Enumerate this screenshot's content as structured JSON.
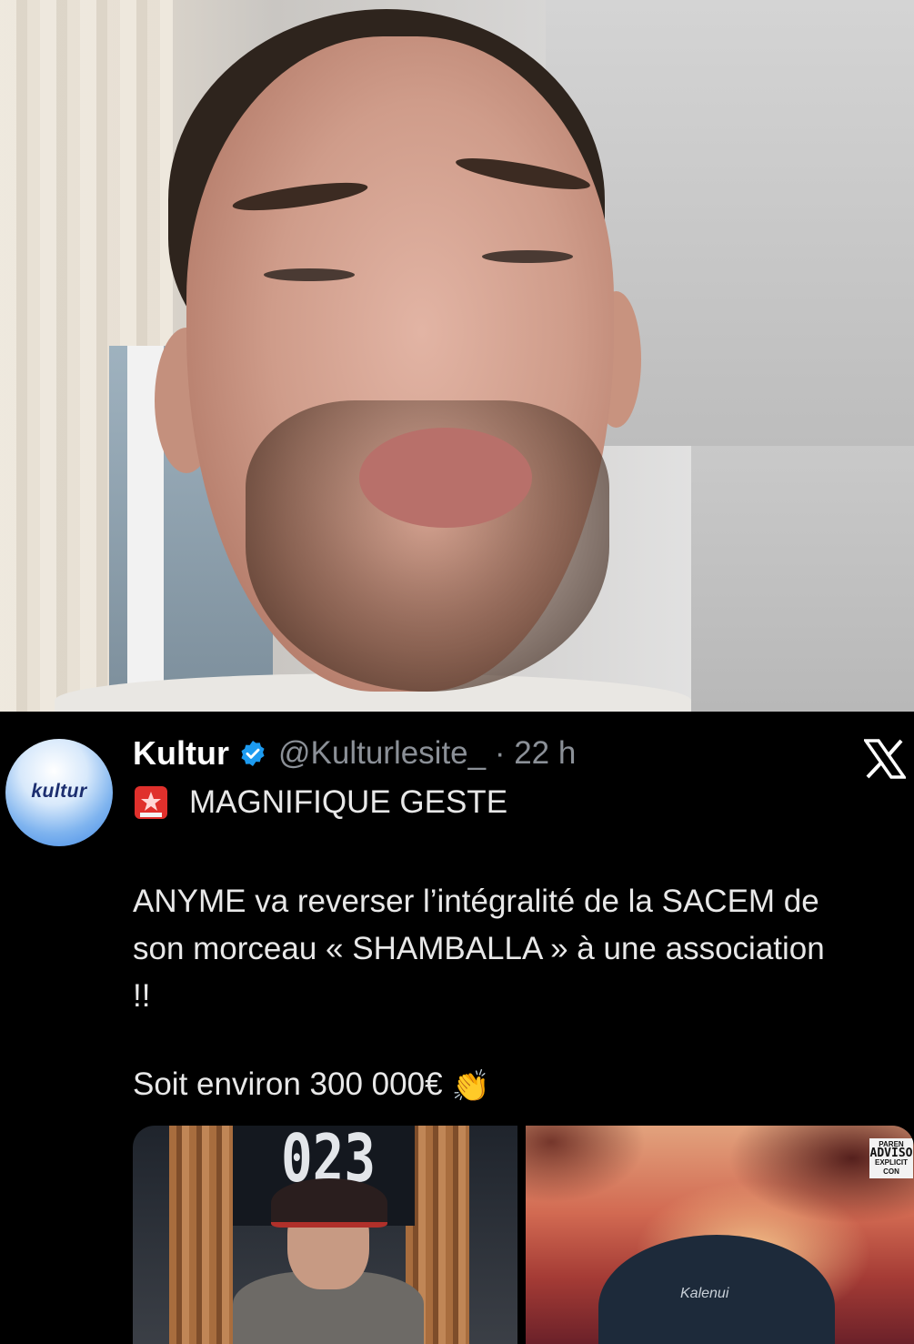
{
  "tweet": {
    "avatar_label": "kultur",
    "name": "Kultur",
    "handle_time": "@Kulturlesite_ · 22 h",
    "headline": "MAGNIFIQUE GESTE",
    "body_line1": "ANYME va reverser l’intégralité de la SACEM de",
    "body_line2": "son morceau « SHAMBALLA » à une association",
    "body_line3": "!!",
    "body_line4": "Soit environ 300 000€",
    "clap_emoji": "👏",
    "icons": [
      "verified-badge-icon",
      "x-logo-icon",
      "siren-icon"
    ],
    "colors": {
      "background": "#000000",
      "text": "#e8e8e8",
      "muted": "#8b9097",
      "verified": "#1d9bf0"
    }
  },
  "media": {
    "left_jersey_number": "023",
    "right_beanie_logo": "Kalenui",
    "right_advisory_top": "PAREN",
    "right_advisory_main": "ADVISO",
    "right_advisory_bottom": "EXPLICIT CON"
  }
}
